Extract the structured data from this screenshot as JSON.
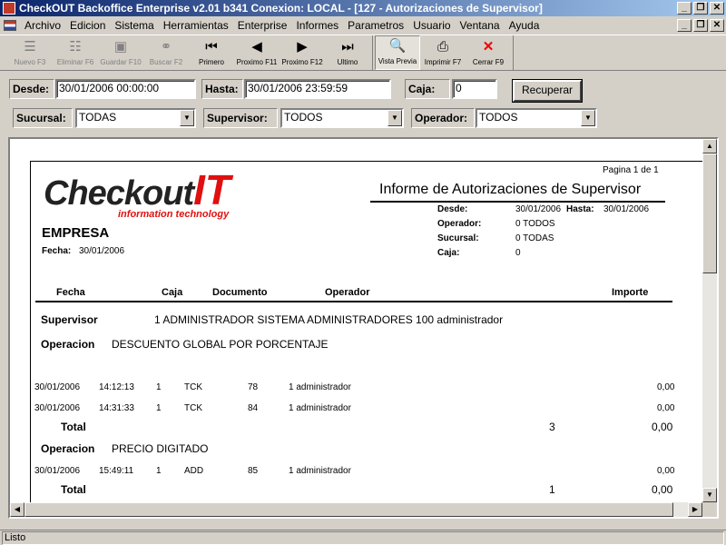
{
  "window": {
    "title": "CheckOUT Backoffice Enterprise v2.01 b341 Conexion: LOCAL - [127 - Autorizaciones de Supervisor]",
    "min": "_",
    "max": "❐",
    "close": "✕"
  },
  "menu": [
    "Archivo",
    "Edicion",
    "Sistema",
    "Herramientas",
    "Enterprise",
    "Informes",
    "Parametros",
    "Usuario",
    "Ventana",
    "Ayuda"
  ],
  "toolbar": {
    "nuevo": "Nuevo F3",
    "eliminar": "Eliminar F6",
    "guardar": "Guardar F10",
    "buscar": "Buscar F2",
    "primero": "Primero",
    "proximo_f11": "Proximo F11",
    "proximo_f12": "Proximo F12",
    "ultimo": "Ultimo",
    "vista_previa": "Vista Previa",
    "imprimir": "Imprimir F7",
    "cerrar": "Cerrar F9"
  },
  "filters": {
    "desde_label": "Desde:",
    "desde_value": "30/01/2006 00:00:00",
    "hasta_label": "Hasta:",
    "hasta_value": "30/01/2006 23:59:59",
    "caja_label": "Caja:",
    "caja_value": "0",
    "recuperar": "Recuperar",
    "sucursal_label": "Sucursal:",
    "sucursal_value": "TODAS",
    "supervisor_label": "Supervisor:",
    "supervisor_value": "TODOS",
    "operador_label": "Operador:",
    "operador_value": "TODOS"
  },
  "report": {
    "pagina": "Pagina 1 de 1",
    "logo_main": "Checkout",
    "logo_it": "IT",
    "logo_tag": "information technology",
    "title": "Informe de Autorizaciones de Supervisor",
    "empresa": "EMPRESA",
    "fecha_label": "Fecha:",
    "fecha_value": "30/01/2006",
    "desde_label": "Desde:",
    "desde_value": "30/01/2006",
    "hasta_label": "Hasta:",
    "hasta_value": "30/01/2006",
    "operador_label": "Operador:",
    "operador_value": "0 TODOS",
    "sucursal_label": "Sucursal:",
    "sucursal_value": "0 TODAS",
    "caja_label": "Caja:",
    "caja_value": "0",
    "columns": {
      "fecha": "Fecha",
      "caja": "Caja",
      "documento": "Documento",
      "operador": "Operador",
      "importe": "Importe"
    },
    "supervisor_label": "Supervisor",
    "supervisor_value": "1  ADMINISTRADOR SISTEMA ADMINISTRADORES 100 administrador",
    "operacion_label": "Operacion",
    "op1_name": "DESCUENTO GLOBAL POR PORCENTAJE",
    "op1_rows": [
      {
        "fecha": "30/01/2006",
        "hora": "14:12:13",
        "caja": "1",
        "tipo": "TCK",
        "num": "78",
        "operador": "1  administrador",
        "importe": "0,00"
      },
      {
        "fecha": "30/01/2006",
        "hora": "14:31:33",
        "caja": "1",
        "tipo": "TCK",
        "num": "84",
        "operador": "1  administrador",
        "importe": "0,00"
      }
    ],
    "total_label": "Total",
    "op1_count": "3",
    "op1_total": "0,00",
    "op2_name": "PRECIO DIGITADO",
    "op2_rows": [
      {
        "fecha": "30/01/2006",
        "hora": "15:49:11",
        "caja": "1",
        "tipo": "ADD",
        "num": "85",
        "operador": "1  administrador",
        "importe": "0,00"
      }
    ],
    "op2_count": "1",
    "op2_total": "0,00"
  },
  "status": "Listo"
}
